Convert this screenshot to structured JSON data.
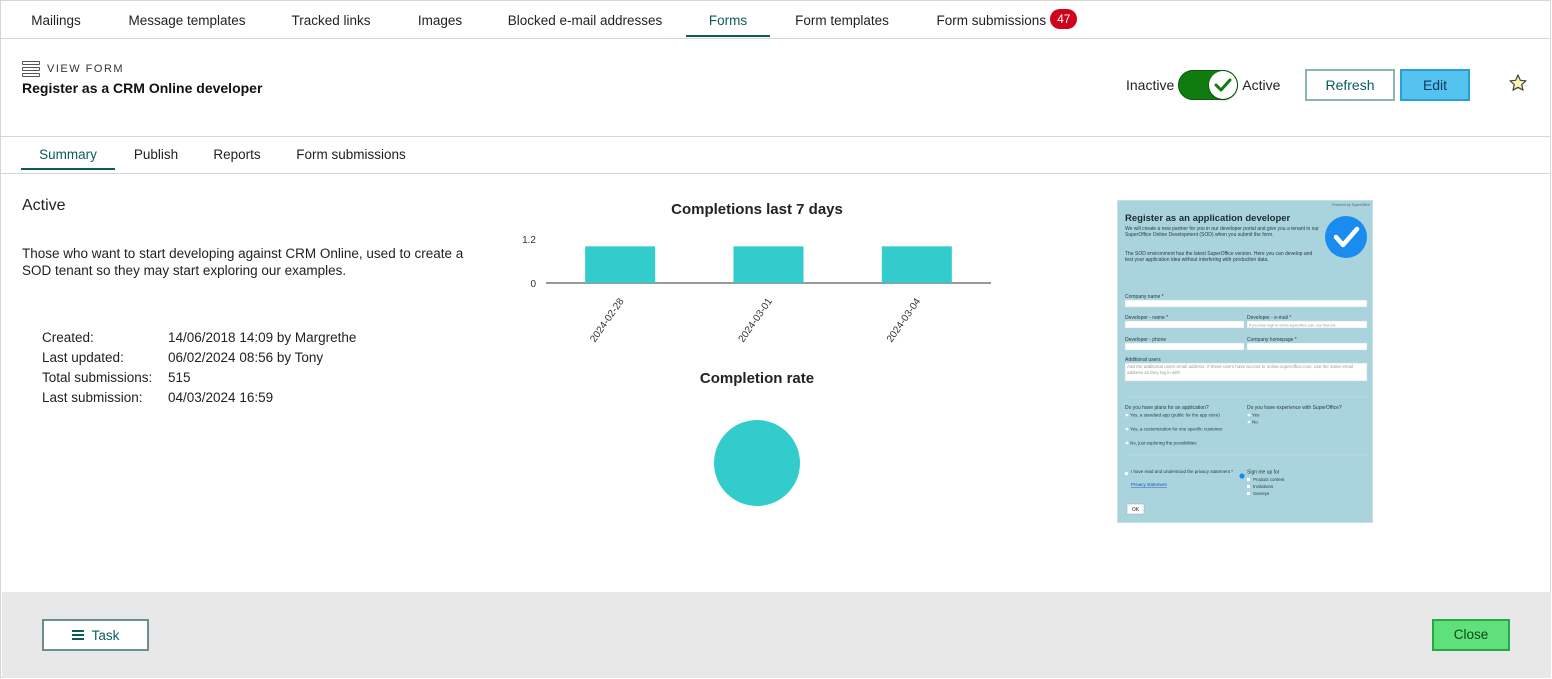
{
  "nav": {
    "tabs": [
      "Mailings",
      "Message templates",
      "Tracked links",
      "Images",
      "Blocked e-mail addresses",
      "Forms",
      "Form templates",
      "Form submissions"
    ],
    "active": "Forms",
    "submissions_badge": "47"
  },
  "header": {
    "view_label": "VIEW FORM",
    "title": "Register as a CRM Online developer",
    "inactive_label": "Inactive",
    "active_label": "Active",
    "toggle_on": true,
    "refresh_label": "Refresh",
    "edit_label": "Edit"
  },
  "subtabs": {
    "items": [
      "Summary",
      "Publish",
      "Reports",
      "Form submissions"
    ],
    "active": "Summary"
  },
  "summary": {
    "status": "Active",
    "description": "Those who want to start developing against CRM Online, used to create a SOD tenant so they may start exploring our examples.",
    "meta": [
      {
        "label": "Created:",
        "value": "14/06/2018 14:09 by Margrethe"
      },
      {
        "label": "Last updated:",
        "value": "06/02/2024 08:56 by Tony"
      },
      {
        "label": "Total submissions:",
        "value": "515"
      },
      {
        "label": "Last submission:",
        "value": "04/03/2024 16:59"
      }
    ]
  },
  "chart_data": [
    {
      "type": "bar",
      "title": "Completions last 7 days",
      "categories": [
        "2024-02-28",
        "2024-03-01",
        "2024-03-04"
      ],
      "values": [
        1,
        1,
        1
      ],
      "ylim": [
        0,
        1.2
      ],
      "yticks": [
        "1.2",
        "0"
      ],
      "color": "#33cccc"
    },
    {
      "type": "pie",
      "title": "Completion rate",
      "values": [
        100
      ],
      "color": "#33cccc"
    }
  ],
  "preview": {
    "title": "Register as an application developer",
    "powered": "Powered by SuperOffice",
    "intro": "We will create a new partner for you in our developer portal and give you a tenant in our SuperOffice Online Development (SOD) when you submit the form.",
    "intro2": "The SOD environment has the latest SuperOffice version. Here you can develop and test your application idea without interfering with production data.",
    "fields": {
      "company": "Company name *",
      "dev_name": "Developer - name *",
      "dev_email": "Developer - e-mail *",
      "email_ph": "If you have login to online.superoffice.com, use that one",
      "dev_phone": "Developer - phone",
      "homepage": "Company homepage *",
      "additional": "Additional users",
      "additional_ph": "Add the additional users email address. If these users have access to online.superoffice.com, use the same email address as they log in with"
    },
    "plans_q": "Do you have plans for an application?",
    "plans": [
      "Yes, a standard app (public for the app store)",
      "Yes, a customization for one specific customer",
      "No, just exploring the possibilities"
    ],
    "exp_q": "Do you have experience with SuperOffice?",
    "exp": [
      "Yes",
      "No"
    ],
    "privacy": "I have read and understood the privacy statement *",
    "privacy_link": "Privacy statement",
    "signup": "Sign me up for",
    "signup_opts": [
      "Product content",
      "Invitations",
      "Surveys"
    ],
    "ok": "OK"
  },
  "footer": {
    "task_label": "Task",
    "close_label": "Close"
  },
  "colors": {
    "accent": "#0b5c5c",
    "toggle": "#107c10",
    "badge": "#d0021b",
    "edit": "#55c3ef",
    "close": "#5fe07a",
    "bar": "#33cccc"
  }
}
